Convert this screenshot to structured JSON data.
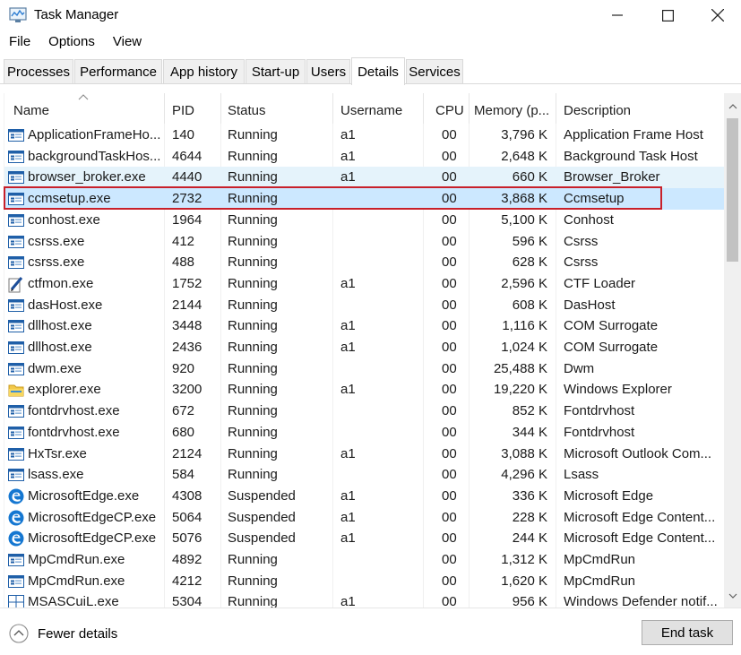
{
  "window": {
    "title": "Task Manager"
  },
  "menu": [
    "File",
    "Options",
    "View"
  ],
  "tabs": [
    "Processes",
    "Performance",
    "App history",
    "Start-up",
    "Users",
    "Details",
    "Services"
  ],
  "active_tab": "Details",
  "columns": [
    "Name",
    "PID",
    "Status",
    "Username",
    "CPU",
    "Memory (p...",
    "Description"
  ],
  "rows": [
    {
      "name": "ApplicationFrameHo...",
      "pid": "140",
      "status": "Running",
      "user": "a1",
      "cpu": "00",
      "mem": "3,796 K",
      "desc": "Application Frame Host",
      "icon": "app-window-icon"
    },
    {
      "name": "backgroundTaskHos...",
      "pid": "4644",
      "status": "Running",
      "user": "a1",
      "cpu": "00",
      "mem": "2,648 K",
      "desc": "Background Task Host",
      "icon": "app-window-icon"
    },
    {
      "name": "browser_broker.exe",
      "pid": "4440",
      "status": "Running",
      "user": "a1",
      "cpu": "00",
      "mem": "660 K",
      "desc": "Browser_Broker",
      "icon": "app-window-icon"
    },
    {
      "name": "ccmsetup.exe",
      "pid": "2732",
      "status": "Running",
      "user": "",
      "cpu": "00",
      "mem": "3,868 K",
      "desc": "Ccmsetup",
      "icon": "app-window-icon"
    },
    {
      "name": "conhost.exe",
      "pid": "1964",
      "status": "Running",
      "user": "",
      "cpu": "00",
      "mem": "5,100 K",
      "desc": "Conhost",
      "icon": "app-window-icon"
    },
    {
      "name": "csrss.exe",
      "pid": "412",
      "status": "Running",
      "user": "",
      "cpu": "00",
      "mem": "596 K",
      "desc": "Csrss",
      "icon": "app-window-icon"
    },
    {
      "name": "csrss.exe",
      "pid": "488",
      "status": "Running",
      "user": "",
      "cpu": "00",
      "mem": "628 K",
      "desc": "Csrss",
      "icon": "app-window-icon"
    },
    {
      "name": "ctfmon.exe",
      "pid": "1752",
      "status": "Running",
      "user": "a1",
      "cpu": "00",
      "mem": "2,596 K",
      "desc": "CTF Loader",
      "icon": "pen-icon"
    },
    {
      "name": "dasHost.exe",
      "pid": "2144",
      "status": "Running",
      "user": "",
      "cpu": "00",
      "mem": "608 K",
      "desc": "DasHost",
      "icon": "app-window-icon"
    },
    {
      "name": "dllhost.exe",
      "pid": "3448",
      "status": "Running",
      "user": "a1",
      "cpu": "00",
      "mem": "1,116 K",
      "desc": "COM Surrogate",
      "icon": "app-window-icon"
    },
    {
      "name": "dllhost.exe",
      "pid": "2436",
      "status": "Running",
      "user": "a1",
      "cpu": "00",
      "mem": "1,024 K",
      "desc": "COM Surrogate",
      "icon": "app-window-icon"
    },
    {
      "name": "dwm.exe",
      "pid": "920",
      "status": "Running",
      "user": "",
      "cpu": "00",
      "mem": "25,488 K",
      "desc": "Dwm",
      "icon": "app-window-icon"
    },
    {
      "name": "explorer.exe",
      "pid": "3200",
      "status": "Running",
      "user": "a1",
      "cpu": "00",
      "mem": "19,220 K",
      "desc": "Windows Explorer",
      "icon": "folder-icon"
    },
    {
      "name": "fontdrvhost.exe",
      "pid": "672",
      "status": "Running",
      "user": "",
      "cpu": "00",
      "mem": "852 K",
      "desc": "Fontdrvhost",
      "icon": "app-window-icon"
    },
    {
      "name": "fontdrvhost.exe",
      "pid": "680",
      "status": "Running",
      "user": "",
      "cpu": "00",
      "mem": "344 K",
      "desc": "Fontdrvhost",
      "icon": "app-window-icon"
    },
    {
      "name": "HxTsr.exe",
      "pid": "2124",
      "status": "Running",
      "user": "a1",
      "cpu": "00",
      "mem": "3,088 K",
      "desc": "Microsoft Outlook Com...",
      "icon": "app-window-icon"
    },
    {
      "name": "lsass.exe",
      "pid": "584",
      "status": "Running",
      "user": "",
      "cpu": "00",
      "mem": "4,296 K",
      "desc": "Lsass",
      "icon": "app-window-icon"
    },
    {
      "name": "MicrosoftEdge.exe",
      "pid": "4308",
      "status": "Suspended",
      "user": "a1",
      "cpu": "00",
      "mem": "336 K",
      "desc": "Microsoft Edge",
      "icon": "edge-icon"
    },
    {
      "name": "MicrosoftEdgeCP.exe",
      "pid": "5064",
      "status": "Suspended",
      "user": "a1",
      "cpu": "00",
      "mem": "228 K",
      "desc": "Microsoft Edge Content...",
      "icon": "edge-icon"
    },
    {
      "name": "MicrosoftEdgeCP.exe",
      "pid": "5076",
      "status": "Suspended",
      "user": "a1",
      "cpu": "00",
      "mem": "244 K",
      "desc": "Microsoft Edge Content...",
      "icon": "edge-icon"
    },
    {
      "name": "MpCmdRun.exe",
      "pid": "4892",
      "status": "Running",
      "user": "",
      "cpu": "00",
      "mem": "1,312 K",
      "desc": "MpCmdRun",
      "icon": "app-window-icon"
    },
    {
      "name": "MpCmdRun.exe",
      "pid": "4212",
      "status": "Running",
      "user": "",
      "cpu": "00",
      "mem": "1,620 K",
      "desc": "MpCmdRun",
      "icon": "app-window-icon"
    },
    {
      "name": "MSASCuiL.exe",
      "pid": "5304",
      "status": "Running",
      "user": "a1",
      "cpu": "00",
      "mem": "956 K",
      "desc": "Windows Defender notif...",
      "icon": "grid-app-icon"
    }
  ],
  "hover_row": 2,
  "selected_row": 3,
  "footer": {
    "fewer_details": "Fewer details",
    "end_task": "End task"
  },
  "colors": {
    "highlight": "#c8202a",
    "selected": "#cce8ff",
    "hover": "#e5f3fb"
  }
}
